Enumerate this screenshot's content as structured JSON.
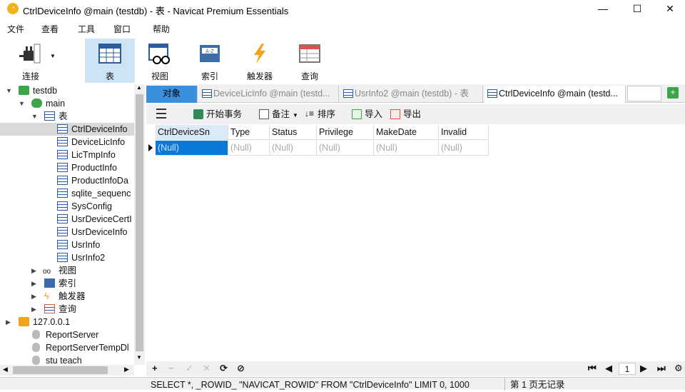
{
  "window": {
    "title": "CtrlDeviceInfo @main (testdb) - 表 - Navicat Premium Essentials",
    "minimize": "—",
    "maximize": "☐",
    "close": "✕"
  },
  "menu": [
    "文件",
    "查看",
    "工具",
    "窗口",
    "帮助"
  ],
  "toolbar": {
    "connect": "连接",
    "table": "表",
    "view": "视图",
    "index": "索引",
    "trigger": "触发器",
    "query": "查询"
  },
  "tree": {
    "testdb": "testdb",
    "main": "main",
    "tables_group": "表",
    "tables": [
      "CtrlDeviceInfo",
      "DeviceLicInfo",
      "LicTmpInfo",
      "ProductInfo",
      "ProductInfoDa",
      "sqlite_sequenc",
      "SysConfig",
      "UsrDeviceCertI",
      "UsrDeviceInfo",
      "UsrInfo",
      "UsrInfo2"
    ],
    "views": "视图",
    "indexes": "索引",
    "triggers": "触发器",
    "queries": "查询",
    "server": "127.0.0.1",
    "server_dbs": [
      "ReportServer",
      "ReportServerTempDl",
      "stu teach"
    ]
  },
  "tabs": {
    "objects": "对象",
    "items": [
      "DeviceLicInfo @main (testd...",
      "UsrInfo2 @main (testdb) - 表",
      "CtrlDeviceInfo @main (testd..."
    ]
  },
  "table_toolbar": {
    "menu_icon": "hamburger-icon",
    "begin_transaction": "开始事务",
    "memo": "备注",
    "sort": "排序",
    "import": "导入",
    "export": "导出"
  },
  "grid": {
    "columns": [
      "CtrlDeviceSn",
      "Type",
      "Status",
      "Privilege",
      "MakeDate",
      "Invalid"
    ],
    "row": [
      "(Null)",
      "(Null)",
      "(Null)",
      "(Null)",
      "(Null)",
      "(Null)"
    ]
  },
  "footer": {
    "add": "+",
    "remove": "−",
    "apply": "✓",
    "discard": "✕",
    "refresh": "⟳",
    "stop": "⊘",
    "page": "1"
  },
  "status": {
    "sql": "SELECT *, _ROWID_ \"NAVICAT_ROWID\" FROM \"CtrlDeviceInfo\" LIMIT 0, 1000",
    "info": "第 1 页无记录"
  },
  "colors": {
    "accent": "#3b8fde",
    "selected_cell": "#0a78d7",
    "active_tool": "#cde4f7"
  }
}
